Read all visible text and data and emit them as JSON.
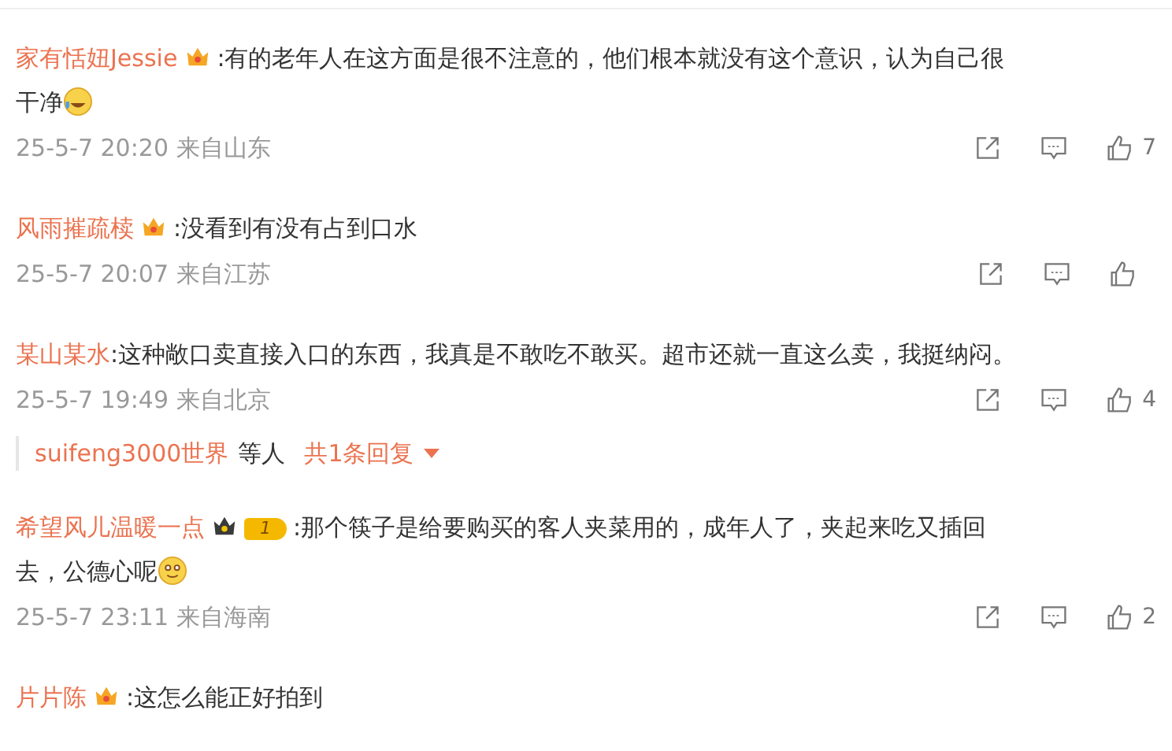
{
  "comments": [
    {
      "name": "家有恬妞Jessie",
      "badge": {
        "kind": "crown"
      },
      "text_lines": [
        ":有的老年人在这方面是很不注意的，他们根本就没有这个意识，认为自己很",
        "干净"
      ],
      "emoji": {
        "kind": "tears"
      },
      "time": "25-5-7 20:20 来自山东",
      "likes": "7"
    },
    {
      "name": "风雨摧疏椟",
      "badge": {
        "kind": "crown"
      },
      "text_lines": [
        ":没看到有没有占到口水"
      ],
      "time": "25-5-7 20:07 来自江苏"
    },
    {
      "name": "某山某水",
      "text_lines": [
        ":这种敞口卖直接入口的东西，我真是不敢吃不敢买。超市还就一直这么卖，我挺纳闷。"
      ],
      "time": "25-5-7 19:49 来自北京",
      "likes": "4",
      "replies": {
        "user": "suifeng3000世界",
        "suffix": "等人",
        "count": "共1条回复"
      }
    },
    {
      "name": "希望风儿温暖一点",
      "badge": {
        "kind": "level",
        "level_text": "1"
      },
      "text_lines": [
        ":那个筷子是给要购买的客人夹菜用的，成年人了，夹起来吃又插回",
        "去，公德心呢"
      ],
      "emoji": {
        "kind": "smile"
      },
      "time": "25-5-7 23:11 来自海南",
      "likes": "2"
    },
    {
      "name": "片片陈",
      "badge": {
        "kind": "crown"
      },
      "text_lines": [
        ":这怎么能正好拍到"
      ]
    }
  ]
}
